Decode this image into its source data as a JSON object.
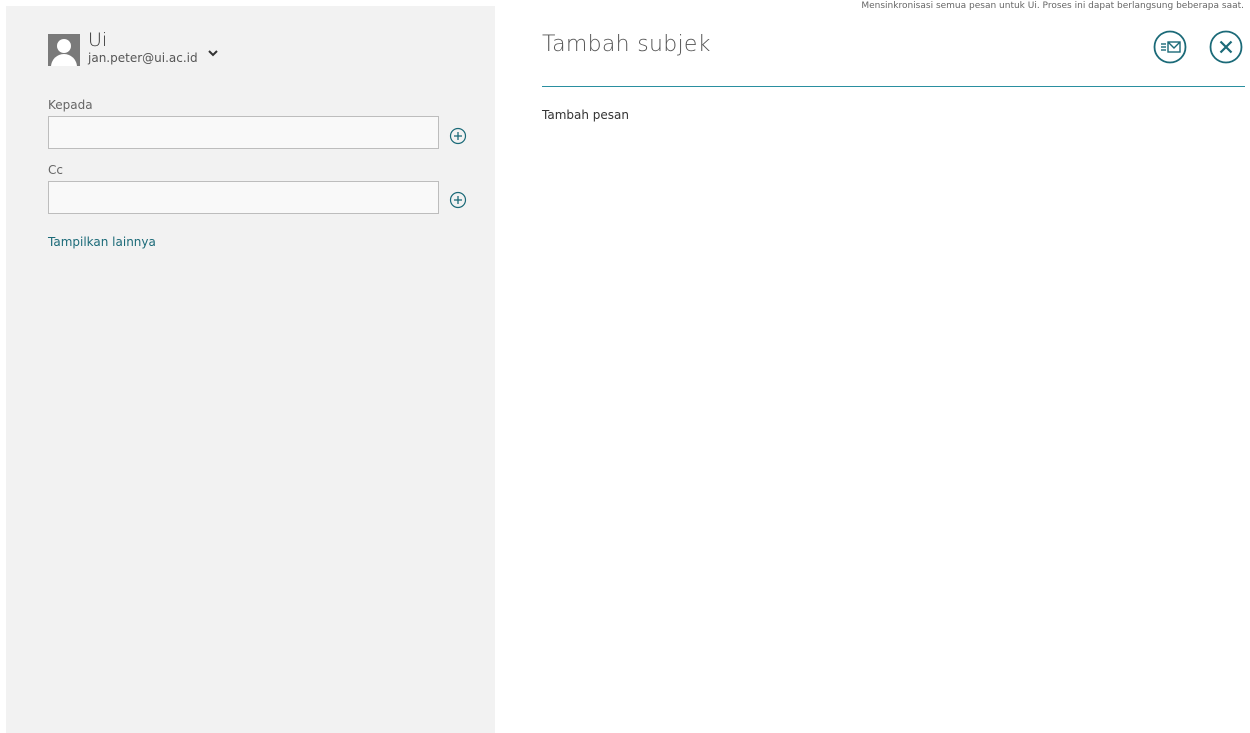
{
  "account": {
    "name": "Ui",
    "email": "jan.peter@ui.ac.id"
  },
  "to_field": {
    "label": "Kepada",
    "value": ""
  },
  "cc_field": {
    "label": "Cc",
    "value": ""
  },
  "show_more_label": "Tampilkan lainnya",
  "sync_status": "Mensinkronisasi semua pesan untuk Ui.  Proses ini dapat berlangsung beberapa saat.",
  "subject": {
    "placeholder": "Tambah subjek"
  },
  "message": {
    "placeholder": "Tambah pesan"
  },
  "icons": {
    "avatar": "person-icon",
    "account_menu": "chevron-down-icon",
    "add_recipient": "plus-circle-icon",
    "send": "send-mail-icon",
    "close": "close-circle-icon"
  },
  "colors": {
    "accent": "#1b6a78",
    "pane_background": "#f2f2f2"
  }
}
